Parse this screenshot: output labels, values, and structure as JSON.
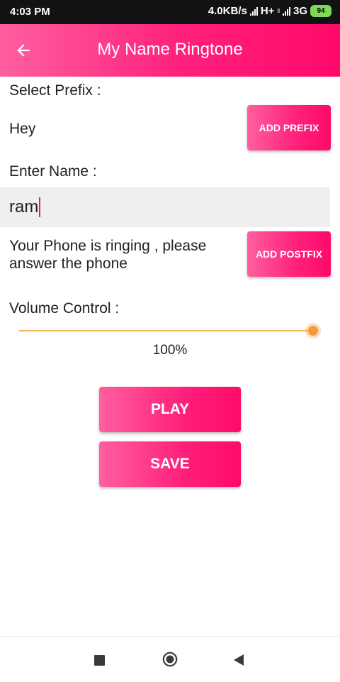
{
  "status_bar": {
    "time": "4:03 PM",
    "speed": "4.0KB/s",
    "net1": "H+",
    "net1_sub": "ll",
    "net2": "3G",
    "battery": "94"
  },
  "app_bar": {
    "title": "My Name Ringtone",
    "back_icon": "arrow-left-icon"
  },
  "prefix": {
    "label": "Select Prefix :",
    "value": "Hey",
    "button_label": "ADD PREFIX"
  },
  "name": {
    "label": "Enter Name :",
    "value": "ram"
  },
  "postfix": {
    "text": "Your Phone is ringing , please answer the phone",
    "button_label": "ADD POSTFIX"
  },
  "volume": {
    "label": "Volume Control :",
    "value_text": "100%",
    "level": 1.0
  },
  "actions": {
    "play_label": "PLAY",
    "save_label": "SAVE"
  },
  "nav_bar": {
    "icons": [
      "square-recents-icon",
      "circle-home-icon",
      "triangle-back-icon"
    ]
  },
  "colors": {
    "accent": "#ff1f7a",
    "slider": "#f39a3c",
    "caret": "#e91e63"
  }
}
